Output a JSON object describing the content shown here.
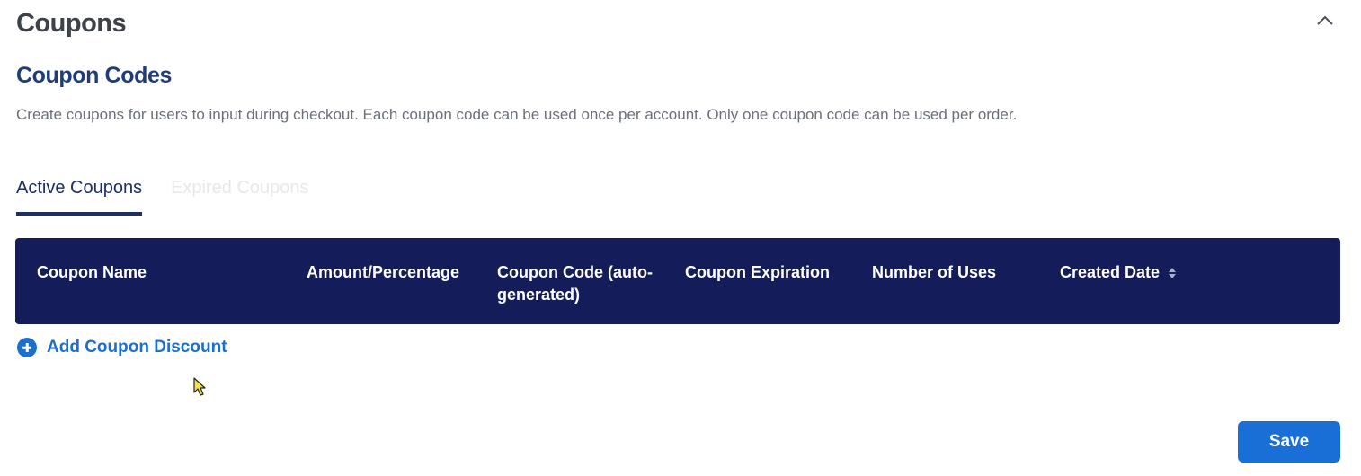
{
  "section": {
    "title": "Coupons",
    "collapse_icon": "chevron-up-icon"
  },
  "coupon_codes": {
    "title": "Coupon Codes",
    "description": "Create coupons for users to input during checkout. Each coupon code can be used once per account. Only one coupon code can be used per order."
  },
  "tabs": [
    {
      "label": "Active Coupons",
      "active": true
    },
    {
      "label": "Expired Coupons",
      "active": false
    }
  ],
  "table": {
    "columns": [
      "Coupon Name",
      "Amount/Percentage",
      "Coupon Code (auto-generated)",
      "Coupon Expiration",
      "Number of Uses",
      "Created Date"
    ],
    "header_bg": "#141d5a",
    "rows": []
  },
  "add_coupon": {
    "label": "Add Coupon Discount",
    "icon": "plus-circle-icon"
  },
  "save_button": {
    "label": "Save",
    "color": "#1a6fd6"
  }
}
